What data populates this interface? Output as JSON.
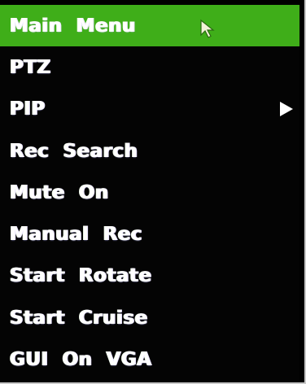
{
  "menu": {
    "items": [
      {
        "label": "Main  Menu"
      },
      {
        "label": "PTZ"
      },
      {
        "label": "PIP"
      },
      {
        "label": "Rec  Search"
      },
      {
        "label": "Mute  On"
      },
      {
        "label": "Manual  Rec"
      },
      {
        "label": "Start  Rotate"
      },
      {
        "label": "Start  Cruise"
      },
      {
        "label": "GUI  On  VGA"
      }
    ]
  },
  "colors": {
    "highlight": "#3fae19",
    "background": "#040404",
    "text": "#ffffff",
    "cursor": "#f3f3d8"
  },
  "icons": {
    "submenu": "submenu-arrow-icon",
    "pointer": "mouse-pointer-icon"
  }
}
